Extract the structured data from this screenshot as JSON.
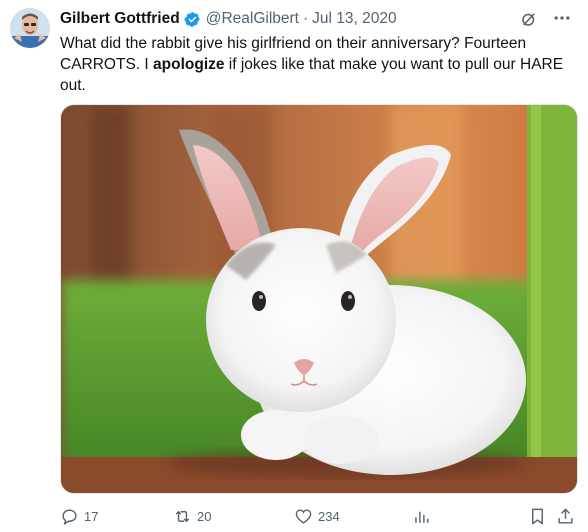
{
  "author": {
    "name": "Gilbert Gottfried",
    "handle": "@RealGilbert",
    "separator": "·",
    "date": "Jul 13, 2020"
  },
  "tweet": {
    "text_part1": "What did the rabbit give his girlfriend on their anniversary? Fourteen CARROTS.  I ",
    "text_bold": "apologize",
    "text_part2": " if jokes like that make you want to pull our HARE out."
  },
  "actions": {
    "replies": "17",
    "reposts": "20",
    "likes": "234"
  },
  "icons": {
    "verified": "verified-badge-icon",
    "grok": "grok-icon",
    "more": "more-icon",
    "reply": "reply-icon",
    "repost": "repost-icon",
    "like": "heart-icon",
    "views": "views-chart-icon",
    "bookmark": "bookmark-icon",
    "share": "share-icon"
  },
  "colors": {
    "verified": "#1d9bf0",
    "text": "#0f1419",
    "secondary": "#536471"
  }
}
